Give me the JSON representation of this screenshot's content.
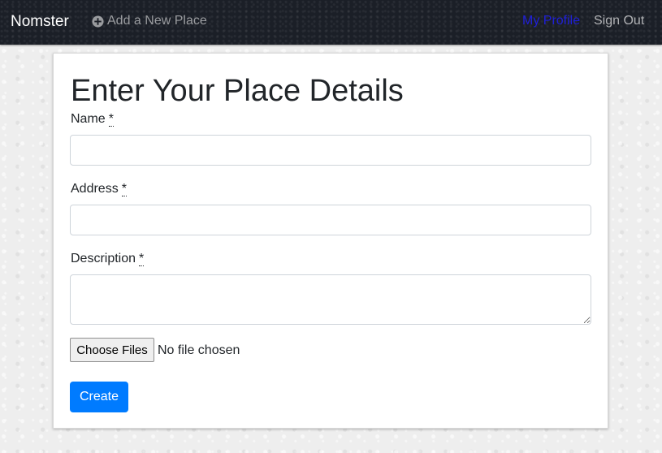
{
  "navbar": {
    "brand": "Nomster",
    "add_place_label": "Add a New Place",
    "add_icon": "plus-circle-icon",
    "profile_label": "My Profile",
    "signout_label": "Sign Out",
    "profile_color": "#1f1fd8"
  },
  "form": {
    "title": "Enter Your Place Details",
    "name_label": "Name",
    "address_label": "Address",
    "description_label": "Description",
    "required_marker": "*",
    "name_value": "",
    "address_value": "",
    "description_value": "",
    "file_button_label": "Choose Files",
    "file_status": "No file chosen",
    "submit_label": "Create",
    "submit_color": "#007bff"
  }
}
